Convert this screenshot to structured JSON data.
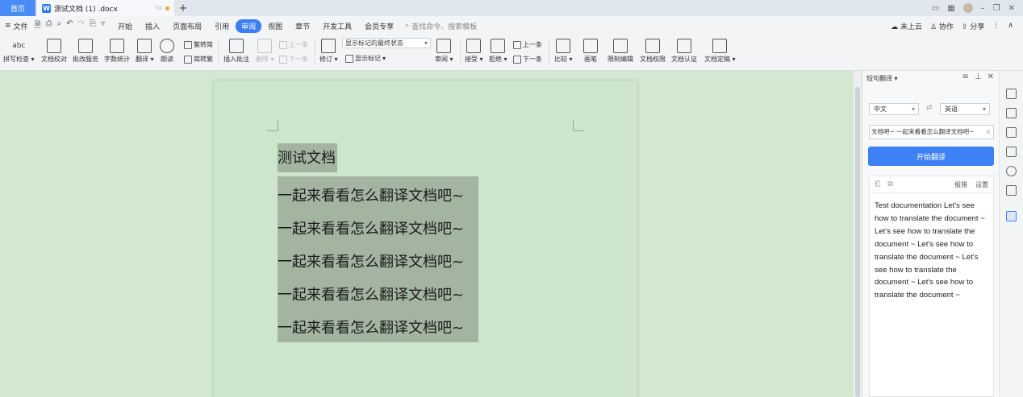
{
  "titlebar": {
    "home_tab": "首页",
    "doc_tab": "测试文档 (1) .docx",
    "new_tab": "+"
  },
  "menubar": {
    "file": "文件",
    "items": [
      "开始",
      "插入",
      "页面布局",
      "引用",
      "审阅",
      "视图",
      "章节",
      "开发工具",
      "会员专享"
    ],
    "active": "审阅",
    "search_placeholder": "查找命令、搜索模板",
    "right": [
      "未上云",
      "协作",
      "分享"
    ]
  },
  "ribbon": {
    "spell": "拼写检查",
    "proof": "文档校对",
    "batch": "批改服务",
    "count": "字数统计",
    "translate": "翻译",
    "read": "朗读",
    "trad_simp": "繁转简",
    "simp_trad": "简转繁",
    "insert_comment": "插入批注",
    "delete": "删除",
    "prev": "上一条",
    "next": "下一条",
    "revise": "修订",
    "markup_state": "显示标记的最终状态",
    "show_markup": "显示标记",
    "review": "审阅",
    "accept": "接受",
    "reject": "拒绝",
    "prev2": "上一条",
    "next2": "下一条",
    "compare": "比较",
    "pen": "画笔",
    "restrict": "限制编辑",
    "permission": "文档权限",
    "auth": "文档认证",
    "finalize": "文档定稿"
  },
  "document": {
    "title_line": "测试文档",
    "lines": [
      "一起来看看怎么翻译文档吧~",
      "一起来看看怎么翻译文档吧~",
      "一起来看看怎么翻译文档吧~",
      "一起来看看怎么翻译文档吧~",
      "一起来看看怎么翻译文档吧~"
    ]
  },
  "panel": {
    "title": "短句翻译",
    "source_lang": "中文",
    "target_lang": "英语",
    "source_text": "文档吧~ 一起来看看怎么翻译文档吧~",
    "translate_button": "开始翻译",
    "report": "报错",
    "settings": "设置",
    "result": "Test documentation Let's see how to translate the document ~ Let's see how to translate the document ~ Let's see how to translate the document ~ Let's see how to translate the document ~ Let's see how to translate the document ~"
  },
  "colors": {
    "accent": "#3d81f5",
    "doc_background": "#cce5cb",
    "highlight": "#a3b5a1"
  }
}
